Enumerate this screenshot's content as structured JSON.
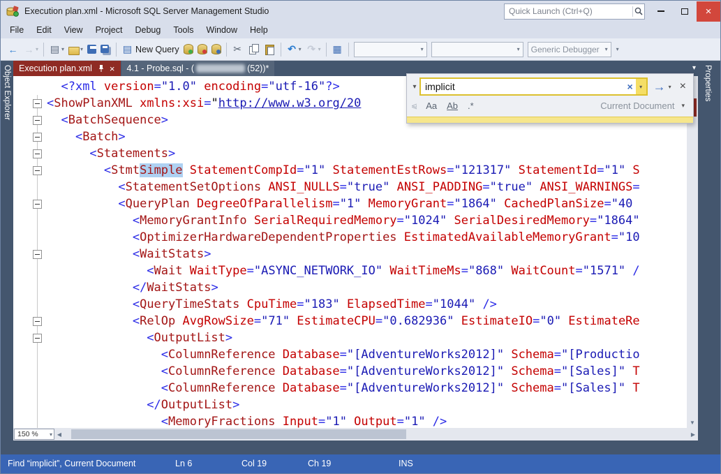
{
  "window": {
    "title": "Execution plan.xml - Microsoft SQL Server Management Studio",
    "quick_launch_placeholder": "Quick Launch (Ctrl+Q)"
  },
  "menu": {
    "items": [
      "File",
      "Edit",
      "View",
      "Project",
      "Debug",
      "Tools",
      "Window",
      "Help"
    ]
  },
  "toolbar": {
    "items": [
      {
        "name": "navigate-back"
      },
      {
        "name": "navigate-forward",
        "disabled": true,
        "caret": true
      },
      {
        "sep": true
      },
      {
        "name": "new-project",
        "caret": true
      },
      {
        "name": "open-file",
        "caret": true
      },
      {
        "name": "save"
      },
      {
        "name": "save-all"
      },
      {
        "sep": true
      },
      {
        "name": "new-query",
        "label": "New Query"
      },
      {
        "name": "database-1"
      },
      {
        "name": "database-2"
      },
      {
        "name": "database-3"
      },
      {
        "sep": true
      },
      {
        "name": "cut"
      },
      {
        "name": "copy"
      },
      {
        "name": "paste"
      },
      {
        "sep": true
      },
      {
        "name": "undo",
        "caret": true
      },
      {
        "name": "redo",
        "disabled": true,
        "caret": true
      },
      {
        "sep": true
      },
      {
        "name": "execution-plan"
      },
      {
        "sep": true
      },
      {
        "combo": true,
        "name": "toolbar-combo-1",
        "value": "",
        "width": "w-combo1"
      },
      {
        "combo": true,
        "name": "toolbar-combo-2",
        "value": "",
        "width": "w-combo2"
      },
      {
        "combo": true,
        "name": "debugger-combo",
        "value": "Generic Debugger",
        "width": "w-debug"
      },
      {
        "name": "toolbar-options",
        "caretOnly": true
      }
    ]
  },
  "side_strips": {
    "left": "Object Explorer",
    "right": "Properties"
  },
  "tabs": [
    {
      "label": "Execution plan.xml",
      "active": true
    },
    {
      "prefix": "4.1 - Probe.sql - (",
      "suffix": "(52))*",
      "active": false
    }
  ],
  "find_panel": {
    "query": "implicit",
    "match_case": "Aa",
    "whole_word": "Ab",
    "regex": ".*",
    "scope": "Current Document"
  },
  "editor": {
    "zoom": "150 %",
    "lines": [
      {
        "i": 2,
        "f": false,
        "s": [
          [
            "d",
            "<?xml"
          ],
          [
            "a",
            " version"
          ],
          [
            "d",
            "="
          ],
          [
            "v",
            "\"1.0\""
          ],
          [
            "a",
            " encoding"
          ],
          [
            "d",
            "="
          ],
          [
            "v",
            "\"utf-16\""
          ],
          [
            "d",
            "?>"
          ]
        ]
      },
      {
        "i": 0,
        "f": true,
        "s": [
          [
            "d",
            "<"
          ],
          [
            "n",
            "ShowPlanXML"
          ],
          [
            "a",
            " xmlns:xsi"
          ],
          [
            "d",
            "="
          ],
          [
            "q",
            "\""
          ],
          [
            "u",
            "http://www.w3.org/20"
          ]
        ]
      },
      {
        "i": 2,
        "f": true,
        "s": [
          [
            "d",
            "<"
          ],
          [
            "n",
            "BatchSequence"
          ],
          [
            "d",
            ">"
          ]
        ]
      },
      {
        "i": 4,
        "f": true,
        "s": [
          [
            "d",
            "<"
          ],
          [
            "n",
            "Batch"
          ],
          [
            "d",
            ">"
          ]
        ]
      },
      {
        "i": 6,
        "f": true,
        "s": [
          [
            "d",
            "<"
          ],
          [
            "n",
            "Statements"
          ],
          [
            "d",
            ">"
          ]
        ]
      },
      {
        "i": 8,
        "f": true,
        "s": [
          [
            "d",
            "<"
          ],
          [
            "n",
            "Stmt"
          ],
          [
            "sel",
            "Simple"
          ],
          [
            "a",
            " StatementCompId"
          ],
          [
            "d",
            "="
          ],
          [
            "v",
            "\"1\""
          ],
          [
            "a",
            " StatementEstRows"
          ],
          [
            "d",
            "="
          ],
          [
            "v",
            "\"121317\""
          ],
          [
            "a",
            " StatementId"
          ],
          [
            "d",
            "="
          ],
          [
            "v",
            "\"1\""
          ],
          [
            "a",
            " S"
          ]
        ]
      },
      {
        "i": 10,
        "f": false,
        "s": [
          [
            "d",
            "<"
          ],
          [
            "n",
            "StatementSetOptions"
          ],
          [
            "a",
            " ANSI_NULLS"
          ],
          [
            "d",
            "="
          ],
          [
            "v",
            "\"true\""
          ],
          [
            "a",
            " ANSI_PADDING"
          ],
          [
            "d",
            "="
          ],
          [
            "v",
            "\"true\""
          ],
          [
            "a",
            " ANSI_WARNINGS"
          ],
          [
            "d",
            "="
          ]
        ]
      },
      {
        "i": 10,
        "f": true,
        "s": [
          [
            "d",
            "<"
          ],
          [
            "n",
            "QueryPlan"
          ],
          [
            "a",
            " DegreeOfParallelism"
          ],
          [
            "d",
            "="
          ],
          [
            "v",
            "\"1\""
          ],
          [
            "a",
            " MemoryGrant"
          ],
          [
            "d",
            "="
          ],
          [
            "v",
            "\"1864\""
          ],
          [
            "a",
            " CachedPlanSize"
          ],
          [
            "d",
            "="
          ],
          [
            "v",
            "\"40"
          ]
        ]
      },
      {
        "i": 12,
        "f": false,
        "s": [
          [
            "d",
            "<"
          ],
          [
            "n",
            "MemoryGrantInfo"
          ],
          [
            "a",
            " SerialRequiredMemory"
          ],
          [
            "d",
            "="
          ],
          [
            "v",
            "\"1024\""
          ],
          [
            "a",
            " SerialDesiredMemory"
          ],
          [
            "d",
            "="
          ],
          [
            "v",
            "\"1864\""
          ]
        ]
      },
      {
        "i": 12,
        "f": false,
        "s": [
          [
            "d",
            "<"
          ],
          [
            "n",
            "OptimizerHardwareDependentProperties"
          ],
          [
            "a",
            " EstimatedAvailableMemoryGrant"
          ],
          [
            "d",
            "="
          ],
          [
            "v",
            "\"10"
          ]
        ]
      },
      {
        "i": 12,
        "f": true,
        "s": [
          [
            "d",
            "<"
          ],
          [
            "n",
            "WaitStats"
          ],
          [
            "d",
            ">"
          ]
        ]
      },
      {
        "i": 14,
        "f": false,
        "s": [
          [
            "d",
            "<"
          ],
          [
            "n",
            "Wait"
          ],
          [
            "a",
            " WaitType"
          ],
          [
            "d",
            "="
          ],
          [
            "v",
            "\"ASYNC_NETWORK_IO\""
          ],
          [
            "a",
            " WaitTimeMs"
          ],
          [
            "d",
            "="
          ],
          [
            "v",
            "\"868\""
          ],
          [
            "a",
            " WaitCount"
          ],
          [
            "d",
            "="
          ],
          [
            "v",
            "\"1571\""
          ],
          [
            "d",
            " /"
          ]
        ]
      },
      {
        "i": 12,
        "f": false,
        "s": [
          [
            "d",
            "</"
          ],
          [
            "n",
            "WaitStats"
          ],
          [
            "d",
            ">"
          ]
        ]
      },
      {
        "i": 12,
        "f": false,
        "s": [
          [
            "d",
            "<"
          ],
          [
            "n",
            "QueryTimeStats"
          ],
          [
            "a",
            " CpuTime"
          ],
          [
            "d",
            "="
          ],
          [
            "v",
            "\"183\""
          ],
          [
            "a",
            " ElapsedTime"
          ],
          [
            "d",
            "="
          ],
          [
            "v",
            "\"1044\""
          ],
          [
            "d",
            " />"
          ]
        ]
      },
      {
        "i": 12,
        "f": true,
        "s": [
          [
            "d",
            "<"
          ],
          [
            "n",
            "RelOp"
          ],
          [
            "a",
            " AvgRowSize"
          ],
          [
            "d",
            "="
          ],
          [
            "v",
            "\"71\""
          ],
          [
            "a",
            " EstimateCPU"
          ],
          [
            "d",
            "="
          ],
          [
            "v",
            "\"0.682936\""
          ],
          [
            "a",
            " EstimateIO"
          ],
          [
            "d",
            "="
          ],
          [
            "v",
            "\"0\""
          ],
          [
            "a",
            " EstimateRe"
          ]
        ]
      },
      {
        "i": 14,
        "f": true,
        "s": [
          [
            "d",
            "<"
          ],
          [
            "n",
            "OutputList"
          ],
          [
            "d",
            ">"
          ]
        ]
      },
      {
        "i": 16,
        "f": false,
        "s": [
          [
            "d",
            "<"
          ],
          [
            "n",
            "ColumnReference"
          ],
          [
            "a",
            " Database"
          ],
          [
            "d",
            "="
          ],
          [
            "v",
            "\"[AdventureWorks2012]\""
          ],
          [
            "a",
            " Schema"
          ],
          [
            "d",
            "="
          ],
          [
            "v",
            "\"[Productio"
          ]
        ]
      },
      {
        "i": 16,
        "f": false,
        "s": [
          [
            "d",
            "<"
          ],
          [
            "n",
            "ColumnReference"
          ],
          [
            "a",
            " Database"
          ],
          [
            "d",
            "="
          ],
          [
            "v",
            "\"[AdventureWorks2012]\""
          ],
          [
            "a",
            " Schema"
          ],
          [
            "d",
            "="
          ],
          [
            "v",
            "\"[Sales]\""
          ],
          [
            "a",
            " T"
          ]
        ]
      },
      {
        "i": 16,
        "f": false,
        "s": [
          [
            "d",
            "<"
          ],
          [
            "n",
            "ColumnReference"
          ],
          [
            "a",
            " Database"
          ],
          [
            "d",
            "="
          ],
          [
            "v",
            "\"[AdventureWorks2012]\""
          ],
          [
            "a",
            " Schema"
          ],
          [
            "d",
            "="
          ],
          [
            "v",
            "\"[Sales]\""
          ],
          [
            "a",
            " T"
          ]
        ]
      },
      {
        "i": 14,
        "f": false,
        "s": [
          [
            "d",
            "</"
          ],
          [
            "n",
            "OutputList"
          ],
          [
            "d",
            ">"
          ]
        ]
      },
      {
        "i": 16,
        "f": false,
        "s": [
          [
            "d",
            "<"
          ],
          [
            "n",
            "MemoryFractions"
          ],
          [
            "a",
            " Input"
          ],
          [
            "d",
            "="
          ],
          [
            "v",
            "\"1\""
          ],
          [
            "a",
            " Output"
          ],
          [
            "d",
            "="
          ],
          [
            "v",
            "\"1\""
          ],
          [
            "d",
            " />"
          ]
        ]
      }
    ]
  },
  "status_bar": {
    "message": "Find “implicit”, Current Document",
    "line": "Ln 6",
    "column": "Col 19",
    "character": "Ch 19",
    "mode": "INS"
  }
}
